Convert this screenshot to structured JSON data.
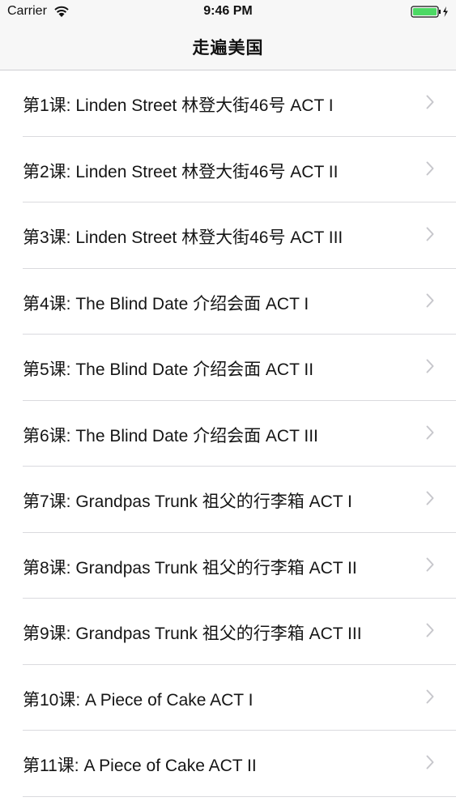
{
  "status_bar": {
    "carrier": "Carrier",
    "time": "9:46 PM",
    "wifi_icon": "wifi-icon",
    "battery_icon": "battery-charging-icon",
    "battery_color": "#4cd964"
  },
  "nav": {
    "title": "走遍美国"
  },
  "lessons": [
    {
      "label": "第1课: Linden Street 林登大街46号 ACT I"
    },
    {
      "label": "第2课: Linden Street 林登大街46号 ACT II"
    },
    {
      "label": "第3课: Linden Street 林登大街46号 ACT III"
    },
    {
      "label": "第4课: The Blind Date 介绍会面 ACT I"
    },
    {
      "label": "第5课: The Blind Date 介绍会面 ACT II"
    },
    {
      "label": "第6课: The Blind Date 介绍会面 ACT III"
    },
    {
      "label": "第7课: Grandpas Trunk 祖父的行李箱 ACT I"
    },
    {
      "label": "第8课: Grandpas Trunk 祖父的行李箱 ACT II"
    },
    {
      "label": "第9课: Grandpas Trunk 祖父的行李箱 ACT III"
    },
    {
      "label": "第10课: A Piece of Cake ACT I"
    },
    {
      "label": "第11课: A Piece of Cake ACT II"
    }
  ],
  "row_disclosure_icon": "chevron-right-icon"
}
